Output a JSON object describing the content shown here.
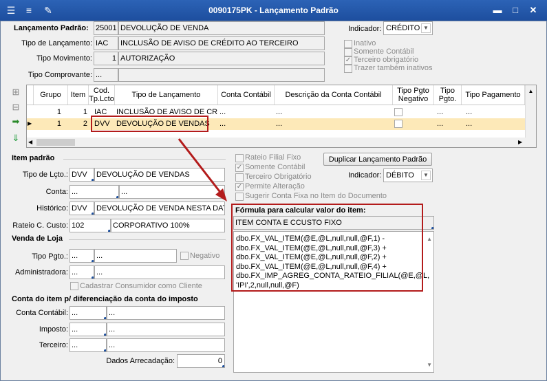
{
  "window": {
    "title": "0090175PK - Lançamento Padrão",
    "min": "▬",
    "max": "□",
    "close": "✕"
  },
  "header": {
    "lancamento_label": "Lançamento Padrão:",
    "lancamento_code": "25001",
    "lancamento_desc": "DEVOLUÇÃO DE VENDA",
    "tipo_lanc_label": "Tipo de Lançamento:",
    "tipo_lanc_code": "IAC",
    "tipo_lanc_desc": "INCLUSÃO DE AVISO DE CRÉDITO AO TERCEIRO",
    "tipo_mov_label": "Tipo Movimento:",
    "tipo_mov_code": "1",
    "tipo_mov_desc": "AUTORIZAÇÃO",
    "tipo_comp_label": "Tipo Comprovante:",
    "tipo_comp_code": "...",
    "indicador_label": "Indicador:",
    "indicador_value": "CRÉDITO",
    "inativo": "Inativo",
    "somente_contabil": "Somente Contábil",
    "terceiro_obrig": "Terceiro obrigatório",
    "trazer_inativos": "Trazer também inativos"
  },
  "grid": {
    "headers": [
      "Grupo",
      "Item",
      "Cod. Tp.Lcto",
      "Tipo de Lançamento",
      "Conta Contábil",
      "Descrição da Conta Contábil",
      "Tipo Pgto Negativo",
      "Tipo Pgto.",
      "Tipo Pagamento"
    ],
    "rows": [
      {
        "grupo": "1",
        "item": "1",
        "cod": "IAC",
        "tipo": "INCLUSÃO DE AVISO DE CRÉDI",
        "conta": "...",
        "desc": "...",
        "pgto": "...",
        "pag": "..."
      },
      {
        "grupo": "1",
        "item": "2",
        "cod": "DVV",
        "tipo": "DEVOLUÇÃO DE VENDAS",
        "conta": "...",
        "desc": "...",
        "pgto": "...",
        "pag": "..."
      }
    ]
  },
  "item": {
    "section": "Item padrão",
    "tipo_lcto_label": "Tipo de Lçto.:",
    "tipo_lcto_code": "DVV",
    "tipo_lcto_desc": "DEVOLUÇÃO DE VENDAS",
    "conta_label": "Conta:",
    "conta_a": "...",
    "conta_b": "...",
    "historico_label": "Histórico:",
    "historico_code": "DVV",
    "historico_desc": "DEVOLUÇÃO DE VENDA NESTA DATA",
    "rateio_label": "Rateio C. Custo:",
    "rateio_code": "102",
    "rateio_desc": "CORPORATIVO 100%",
    "rateio_filial": "Rateio Filial Fixo",
    "somente_contabil": "Somente Contábil",
    "terceiro_obrig": "Terceiro Obrigatório",
    "permite_alt": "Permite Alteração",
    "sugerir": "Sugerir Conta Fixa no Item do Documento",
    "duplicar": "Duplicar Lançamento Padrão",
    "indicador_label": "Indicador:",
    "indicador_value": "DÉBITO",
    "formula_title": "Fórmula para calcular valor do item:",
    "formula_name": "ITEM CONTA E CCUSTO FIXO",
    "formula_lines": [
      "dbo.FX_VAL_ITEM(@E,@L,null,null,@F,1) -",
      "dbo.FX_VAL_ITEM(@E,@L,null,null,@F,3) +",
      "dbo.FX_VAL_ITEM(@E,@L,null,null,@F,2) +",
      "dbo.FX_VAL_ITEM(@E,@L,null,null,@F,4) +",
      "dbo.FX_IMP_AGREG_CONTA_RATEIO_FILIAL(@E,@L,",
      "'IPI',2,null,null,@F)"
    ]
  },
  "loja": {
    "section": "Venda de Loja",
    "tipo_pgto_label": "Tipo Pgto.:",
    "tipo_pgto_a": "...",
    "tipo_pgto_b": "...",
    "negativo": "Negativo",
    "adm_label": "Administradora:",
    "adm_a": "...",
    "adm_b": "...",
    "cadastrar": "Cadastrar Consumidor como Cliente"
  },
  "conta_item": {
    "section": "Conta do item p/ diferenciação da conta do imposto",
    "contabil_label": "Conta Contábil:",
    "contabil_a": "...",
    "contabil_b": "...",
    "imposto_label": "Imposto:",
    "imposto_a": "...",
    "imposto_b": "...",
    "terceiro_label": "Terceiro:",
    "terceiro_a": "...",
    "terceiro_b": "...",
    "dados_label": "Dados Arrecadação:",
    "dados_value": "0"
  },
  "colors": {
    "title": "#1d4e9e",
    "highlight": "#b31b1b",
    "selected_row": "#fde9b8"
  }
}
